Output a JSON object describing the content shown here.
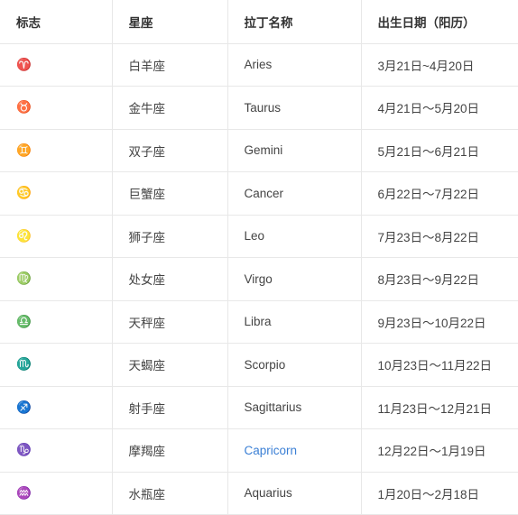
{
  "table": {
    "headers": [
      "标志",
      "星座",
      "拉丁名称",
      "出生日期（阳历）"
    ],
    "rows": [
      {
        "symbol": "♈",
        "cn": "白羊座",
        "latin": "Aries",
        "dates": "3月21日~4月20日",
        "link": false
      },
      {
        "symbol": "♉",
        "cn": "金牛座",
        "latin": "Taurus",
        "dates": "4月21日～5月20日",
        "link": false
      },
      {
        "symbol": "♊",
        "cn": "双子座",
        "latin": "Gemini",
        "dates": "5月21日～6月21日",
        "link": false
      },
      {
        "symbol": "♋",
        "cn": "巨蟹座",
        "latin": "Cancer",
        "dates": "6月22日～7月22日",
        "link": false
      },
      {
        "symbol": "♌",
        "cn": "狮子座",
        "latin": "Leo",
        "dates": "7月23日～8月22日",
        "link": false
      },
      {
        "symbol": "♍",
        "cn": "处女座",
        "latin": "Virgo",
        "dates": "8月23日～9月22日",
        "link": false
      },
      {
        "symbol": "♎",
        "cn": "天秤座",
        "latin": "Libra",
        "dates": "9月23日～10月22日",
        "link": false
      },
      {
        "symbol": "♏",
        "cn": "天蝎座",
        "latin": "Scorpio",
        "dates": "10月23日～11月22日",
        "link": false
      },
      {
        "symbol": "♐",
        "cn": "射手座",
        "latin": "Sagittarius",
        "dates": "11月23日～12月21日",
        "link": false
      },
      {
        "symbol": "♑",
        "cn": "摩羯座",
        "latin": "Capricorn",
        "dates": "12月22日～1月19日",
        "link": true
      },
      {
        "symbol": "♒",
        "cn": "水瓶座",
        "latin": "Aquarius",
        "dates": "1月20日～2月18日",
        "link": false
      }
    ]
  }
}
